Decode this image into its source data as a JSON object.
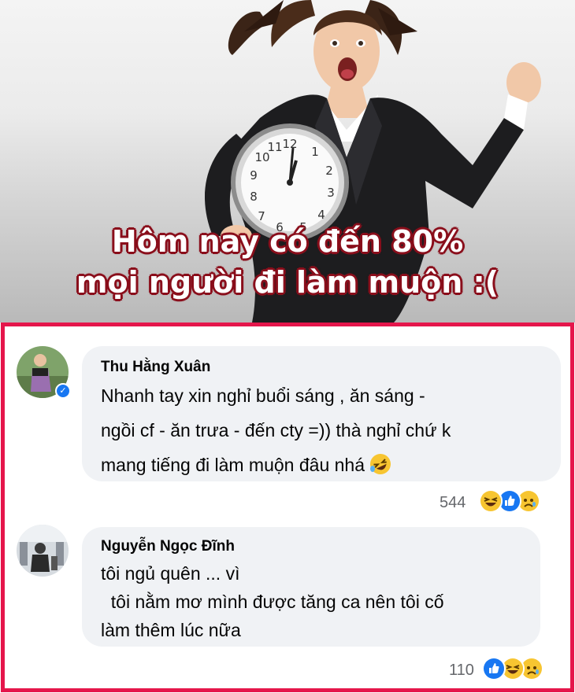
{
  "post": {
    "caption_line1": "Hôm nay có đến 80%",
    "caption_line2": "mọi người đi làm muộn :("
  },
  "colors": {
    "frame_border": "#e5164b",
    "bubble_bg": "#f0f2f5",
    "like_blue": "#1877f2",
    "caption_outline": "#8a0f1c"
  },
  "comments": [
    {
      "author": "Thu Hằng Xuân",
      "verified": true,
      "lines": [
        "Nhanh tay xin nghỉ buổi sáng , ăn sáng -",
        "ngồi cf - ăn trưa - đến cty =)) thà nghỉ chứ k",
        "mang tiếng đi làm muộn đâu nhá"
      ],
      "trailing_emoji": "rolling-laughing-emoji",
      "reaction_count": "544",
      "reactions": [
        "haha-icon",
        "like-icon",
        "sad-icon"
      ]
    },
    {
      "author": "Nguyễn Ngọc Đĩnh",
      "verified": false,
      "lines": [
        "tôi ngủ quên ... vì",
        "  tôi nằm mơ mình được tăng ca nên tôi cố",
        "làm thêm lúc nữa"
      ],
      "reaction_count": "110",
      "reactions": [
        "like-icon",
        "haha-icon",
        "sad-icon"
      ]
    }
  ]
}
